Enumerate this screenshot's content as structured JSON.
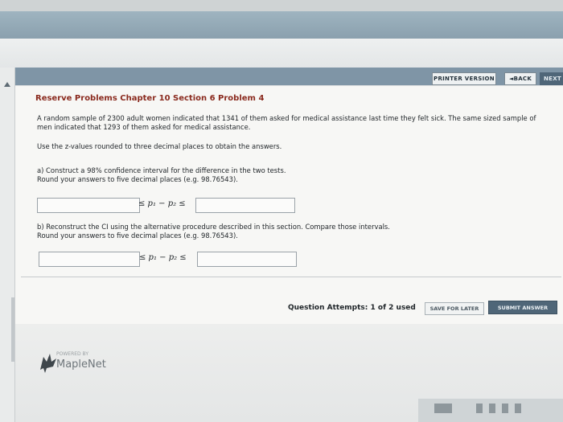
{
  "toolbar": {
    "printer_label": "PRINTER VERSION",
    "back_label": "◄BACK",
    "next_label": "NEXT"
  },
  "problem": {
    "title": "Reserve Problems Chapter 10 Section 6 Problem 4",
    "statement": "A random sample of 2300 adult women indicated that 1341 of them asked for medical assistance last time they felt sick. The same sized sample of men indicated that 1293 of them asked for medical assistance.",
    "instruction": "Use the z-values rounded to three decimal places to obtain the answers.",
    "part_a": {
      "line1": "a) Construct a 98% confidence interval for the difference in the two tests.",
      "line2": "Round your answers to five decimal places (e.g. 98.76543)."
    },
    "part_b": {
      "line1": "b) Reconstruct the CI using the alternative procedure described in this section. Compare those intervals.",
      "line2": "Round your answers to five decimal places (e.g. 98.76543)."
    },
    "inequality": "≤ p₁ − p₂ ≤",
    "answers": {
      "a_lower": "",
      "a_upper": "",
      "b_lower": "",
      "b_upper": ""
    }
  },
  "footer": {
    "attempts": "Question Attempts: 1 of 2 used",
    "save_label": "SAVE FOR LATER",
    "submit_label": "SUBMIT ANSWER"
  },
  "brand": {
    "powered": "POWERED BY",
    "name": "MapleNet"
  },
  "colors": {
    "title": "#8a2a1e",
    "button": "#4f6678",
    "nav_stripe": "#7f95a6"
  }
}
